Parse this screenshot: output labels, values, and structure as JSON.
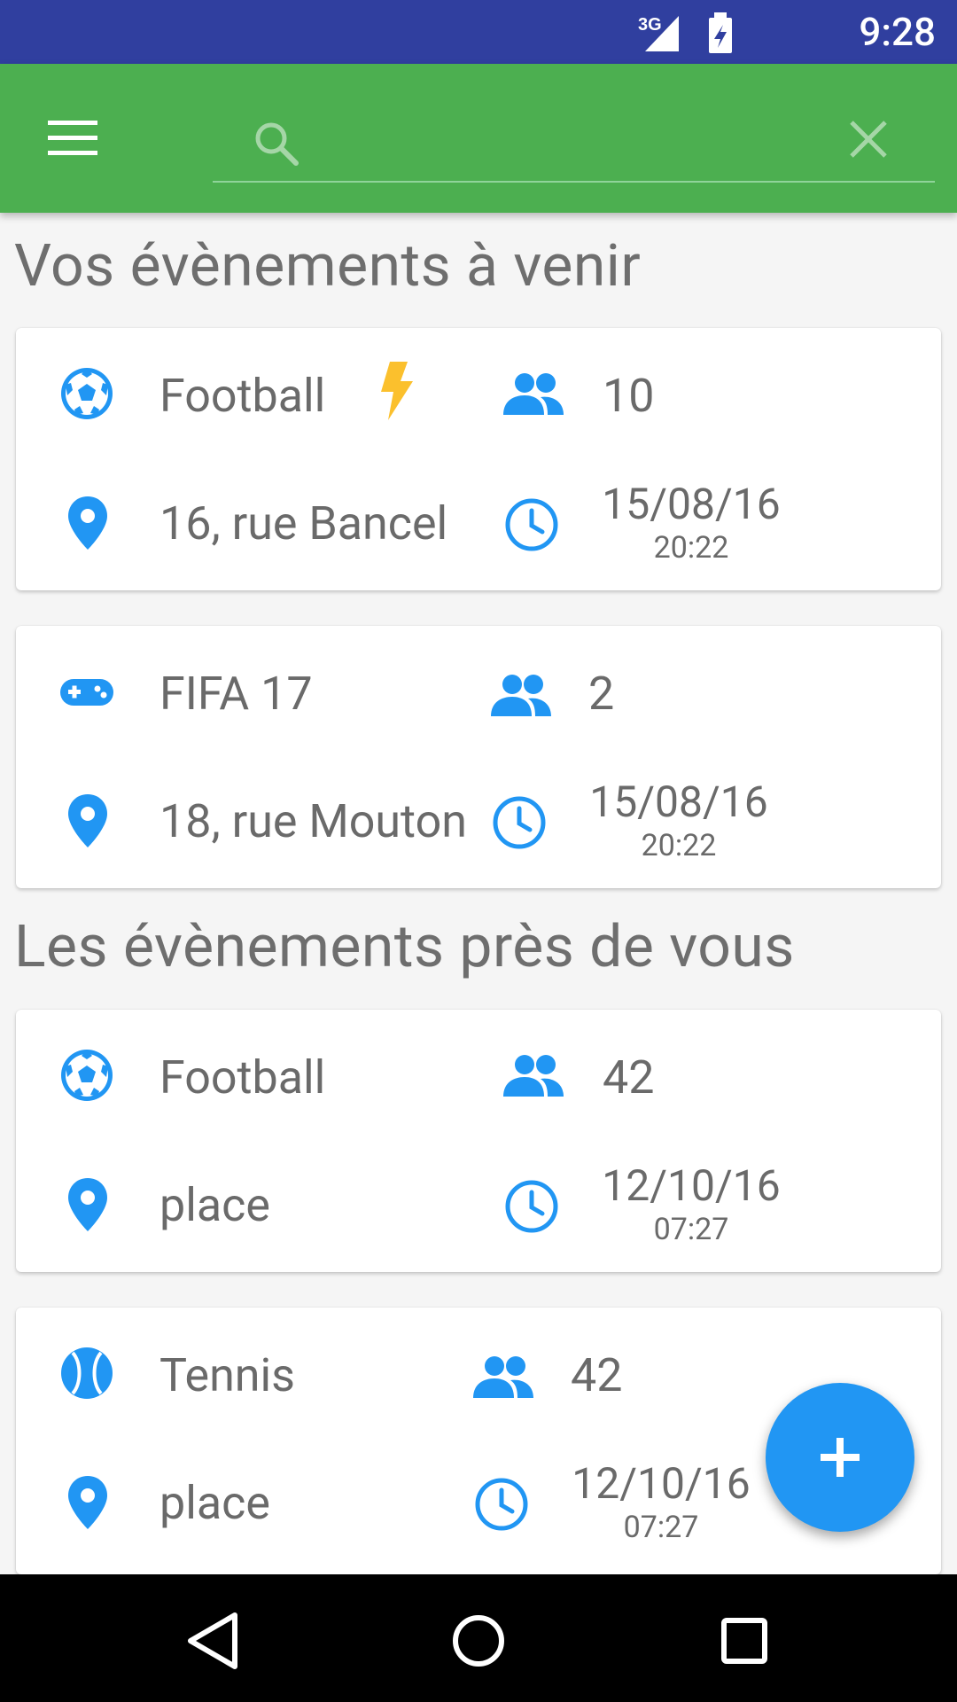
{
  "status_bar": {
    "time": "9:28",
    "network": "3G"
  },
  "search": {
    "placeholder": ""
  },
  "sections": {
    "upcoming_title": "Vos évènements à venir",
    "nearby_title": "Les évènements près de vous"
  },
  "cards": [
    {
      "sport": "Football",
      "sport_icon": "soccer-ball-icon",
      "urgent": true,
      "participants": "10",
      "address": "16, rue Bancel",
      "date": "15/08/16",
      "time": "20:22"
    },
    {
      "sport": "FIFA 17",
      "sport_icon": "gamepad-icon",
      "urgent": false,
      "participants": "2",
      "address": "18, rue Mouton",
      "date": "15/08/16",
      "time": "20:22"
    },
    {
      "sport": "Football",
      "sport_icon": "soccer-ball-icon",
      "urgent": false,
      "participants": "42",
      "address": "place",
      "date": "12/10/16",
      "time": "07:27"
    },
    {
      "sport": "Tennis",
      "sport_icon": "tennis-ball-icon",
      "urgent": false,
      "participants": "42",
      "address": "place",
      "date": "12/10/16",
      "time": "07:27"
    }
  ],
  "fab": {
    "icon": "plus-icon"
  },
  "colors": {
    "primary": "#4caf50",
    "status_bar": "#303f9f",
    "accent": "#2196f3",
    "bolt": "#fbc02d"
  }
}
